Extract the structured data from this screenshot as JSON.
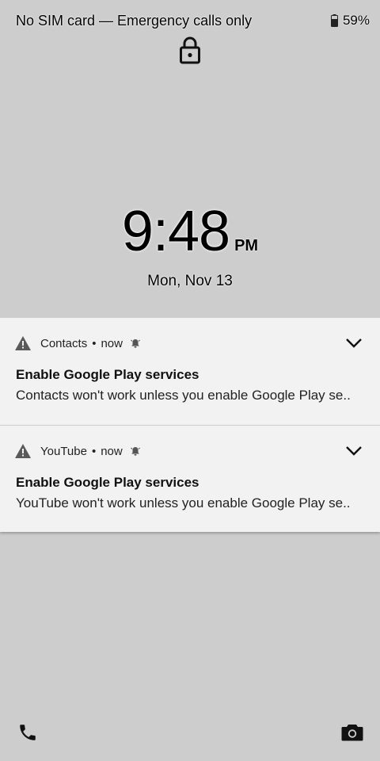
{
  "status_bar": {
    "carrier": "No SIM card — Emergency calls only",
    "battery_level": "59%",
    "battery_icon": "battery-icon"
  },
  "lock": {
    "icon": "lock-icon"
  },
  "clock": {
    "time": "9:48",
    "ampm": "PM",
    "date": "Mon, Nov 13"
  },
  "notifications": [
    {
      "app": "Contacts",
      "separator": "•",
      "time": "now",
      "title": "Enable Google Play services",
      "body": "Contacts won't work unless you enable Google Play se..",
      "icon": "warning-icon"
    },
    {
      "app": "YouTube",
      "separator": "•",
      "time": "now",
      "title": "Enable Google Play services",
      "body": "YouTube won't work unless you enable Google Play se..",
      "icon": "warning-icon"
    }
  ],
  "shortcuts": {
    "left": "phone-icon",
    "right": "camera-icon"
  },
  "colors": {
    "background": "#cdcdcd",
    "card": "#f2f2f2"
  }
}
